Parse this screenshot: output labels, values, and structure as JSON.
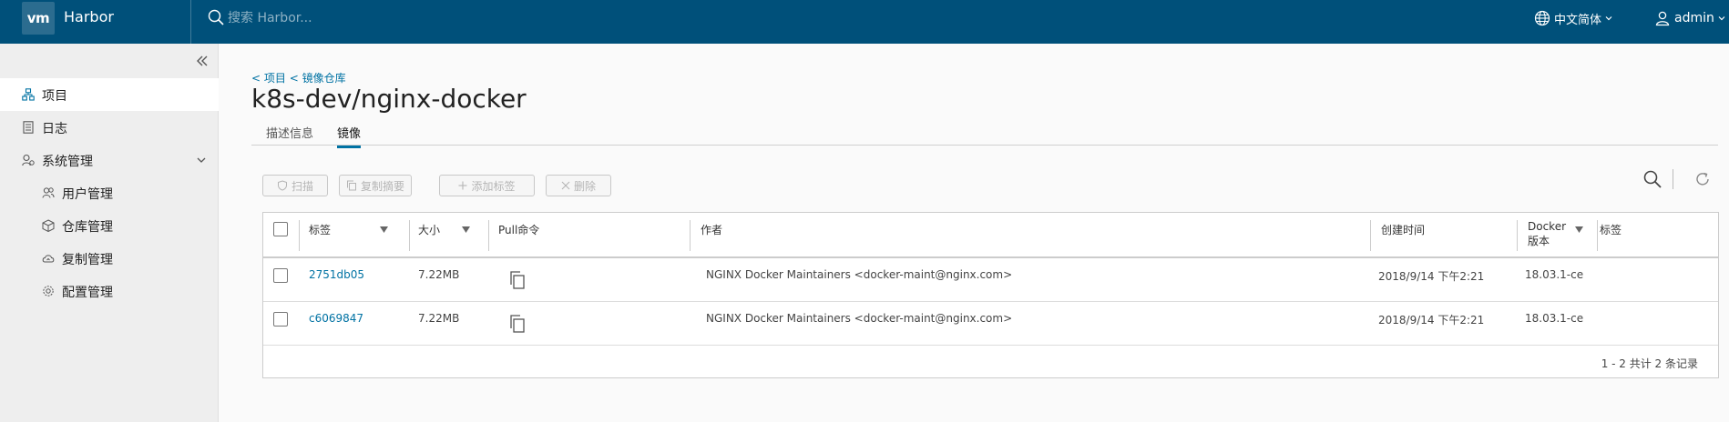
{
  "header": {
    "logo": "vm",
    "app_title": "Harbor",
    "search_placeholder": "搜索 Harbor...",
    "language": "中文简体",
    "user": "admin"
  },
  "sidebar": {
    "items": [
      {
        "label": "项目",
        "icon": "project-icon"
      },
      {
        "label": "日志",
        "icon": "log-icon"
      },
      {
        "label": "系统管理",
        "icon": "admin-icon"
      }
    ],
    "sub_items": [
      {
        "label": "用户管理",
        "icon": "users-icon"
      },
      {
        "label": "仓库管理",
        "icon": "registry-icon"
      },
      {
        "label": "复制管理",
        "icon": "replication-icon"
      },
      {
        "label": "配置管理",
        "icon": "config-icon"
      }
    ]
  },
  "breadcrumb": {
    "items": [
      "< 项目",
      "< 镜像仓库"
    ]
  },
  "page_title": "k8s-dev/nginx-docker",
  "tabs": [
    {
      "label": "描述信息",
      "active": false
    },
    {
      "label": "镜像",
      "active": true
    }
  ],
  "toolbar": {
    "scan": "扫描",
    "copy_digest": "复制摘要",
    "add_label": "添加标签",
    "delete": "删除"
  },
  "table": {
    "columns": [
      "标签",
      "大小",
      "Pull命令",
      "作者",
      "创建时间",
      "Docker",
      "版本",
      "标签"
    ],
    "rows": [
      {
        "tag": "2751db05",
        "size": "7.22MB",
        "author": "NGINX Docker Maintainers <docker-maint@nginx.com>",
        "created": "2018/9/14 下午2:21",
        "docker_version": "18.03.1-ce"
      },
      {
        "tag": "c6069847",
        "size": "7.22MB",
        "author": "NGINX Docker Maintainers <docker-maint@nginx.com>",
        "created": "2018/9/14 下午2:21",
        "docker_version": "18.03.1-ce"
      }
    ],
    "footer": "1 - 2 共计 2 条记录"
  },
  "colors": {
    "header_bg": "#00507a",
    "accent": "#0072a3"
  }
}
